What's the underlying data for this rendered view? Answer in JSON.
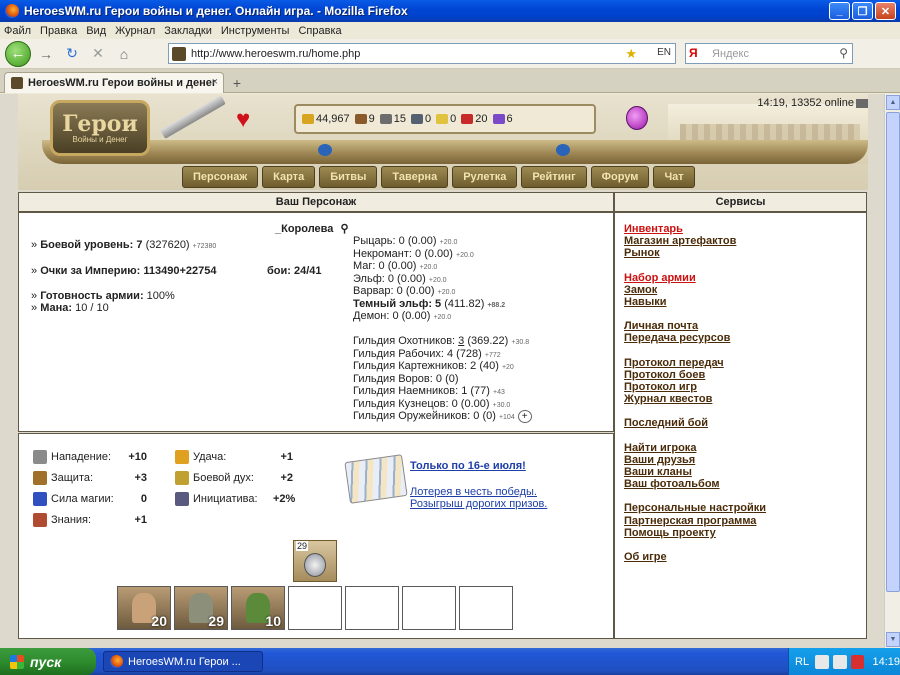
{
  "window": {
    "title": "HeroesWM.ru Герои войны и денег. Онлайн игра. - Mozilla Firefox"
  },
  "menu": [
    "Файл",
    "Правка",
    "Вид",
    "Журнал",
    "Закладки",
    "Инструменты",
    "Справка"
  ],
  "nav": {
    "url": "http://www.heroeswm.ru/home.php",
    "search_placeholder": "Яндекс",
    "lang_indicator": "EN"
  },
  "tab": {
    "title": "HeroesWM.ru Герои войны и денег"
  },
  "game": {
    "logo": {
      "title": "Герои",
      "subtitle": "Войны и Денег"
    },
    "resources": [
      {
        "icon": "gold-icon",
        "value": "44,967",
        "color": "#d8a520"
      },
      {
        "icon": "wood-icon",
        "value": "9",
        "color": "#8b5a2b"
      },
      {
        "icon": "ore-icon",
        "value": "15",
        "color": "#6d6d6d"
      },
      {
        "icon": "mercury-icon",
        "value": "0",
        "color": "#556070"
      },
      {
        "icon": "sulfur-icon",
        "value": "0",
        "color": "#e0c23c"
      },
      {
        "icon": "crystal-icon",
        "value": "20",
        "color": "#c82a2a"
      },
      {
        "icon": "gems-icon",
        "value": "6",
        "color": "#7a4ac8"
      }
    ],
    "online": "14:19, 13352 online",
    "main_menu": [
      "Персонаж",
      "Карта",
      "Битвы",
      "Таверна",
      "Рулетка",
      "Рейтинг",
      "Форум",
      "Чат"
    ]
  },
  "character_panel": {
    "header": "Ваш Персонаж",
    "name": "_Королева",
    "left": {
      "level_label": "Боевой уровень:",
      "level": "7",
      "level_exp": "(327620)",
      "level_exp_bonus": "+72380",
      "empire_label": "Очки за Империю:",
      "empire": "113490+22754",
      "fights": "бои: 24/41",
      "army_ready_label": "Готовность армии:",
      "army_ready": "100%",
      "mana_label": "Мана:",
      "mana": "10 / 10"
    },
    "factions": [
      {
        "name": "Рыцарь:",
        "level": "0",
        "skill": "(0.00)",
        "bonus": "+20.0",
        "bold": false
      },
      {
        "name": "Некромант:",
        "level": "0",
        "skill": "(0.00)",
        "bonus": "+20.0",
        "bold": false
      },
      {
        "name": "Маг:",
        "level": "0",
        "skill": "(0.00)",
        "bonus": "+20.0",
        "bold": false
      },
      {
        "name": "Эльф:",
        "level": "0",
        "skill": "(0.00)",
        "bonus": "+20.0",
        "bold": false
      },
      {
        "name": "Варвар:",
        "level": "0",
        "skill": "(0.00)",
        "bonus": "+20.0",
        "bold": false
      },
      {
        "name": "Темный эльф:",
        "level": "5",
        "skill": "(411.82)",
        "bonus": "+88.2",
        "bold": true
      },
      {
        "name": "Демон:",
        "level": "0",
        "skill": "(0.00)",
        "bonus": "+20.0",
        "bold": false
      }
    ],
    "guilds": [
      {
        "name": "Гильдия Охотников:",
        "level": "3",
        "skill": "(369.22)",
        "bonus": "+30.8"
      },
      {
        "name": "Гильдия Рабочих:",
        "level": "4",
        "skill": "(728)",
        "bonus": "+772"
      },
      {
        "name": "Гильдия Картежников:",
        "level": "2",
        "skill": "(40)",
        "bonus": "+20"
      },
      {
        "name": "Гильдия Воров:",
        "level": "0",
        "skill": "(0)",
        "bonus": ""
      },
      {
        "name": "Гильдия Наемников:",
        "level": "1",
        "skill": "(77)",
        "bonus": "+43"
      },
      {
        "name": "Гильдия Кузнецов:",
        "level": "0",
        "skill": "(0.00)",
        "bonus": "+30.0"
      },
      {
        "name": "Гильдия Оружейников:",
        "level": "0",
        "skill": "(0)",
        "bonus": "+104"
      }
    ],
    "plus_label": "+"
  },
  "stats": {
    "left": [
      {
        "label": "Нападение:",
        "value": "+10",
        "icon": "sword-icon",
        "color": "#8a8a8a"
      },
      {
        "label": "Защита:",
        "value": "+3",
        "icon": "shield-icon",
        "color": "#a0702a"
      },
      {
        "label": "Сила магии:",
        "value": "0",
        "icon": "wand-icon",
        "color": "#3050c0"
      },
      {
        "label": "Знания:",
        "value": "+1",
        "icon": "book-icon",
        "color": "#b04a30"
      }
    ],
    "right": [
      {
        "label": "Удача:",
        "value": "+1",
        "icon": "rainbow-icon",
        "color": "#e0a020"
      },
      {
        "label": "Боевой дух:",
        "value": "+2",
        "icon": "morale-icon",
        "color": "#c0a030"
      },
      {
        "label": "Инициатива:",
        "value": "+2%",
        "icon": "initiative-icon",
        "color": "#5a5a80"
      }
    ]
  },
  "promo": {
    "title": "Только по 16-е июля!",
    "line1": "Лотерея в честь победы.",
    "line2": "Розыгрыш дорогих призов."
  },
  "medal": {
    "count": "29"
  },
  "army_slots": [
    "20",
    "29",
    "10",
    "",
    "",
    "",
    ""
  ],
  "services": {
    "header": "Сервисы",
    "groups": [
      [
        {
          "label": "Инвентарь",
          "highlight": true
        },
        {
          "label": "Магазин артефактов"
        },
        {
          "label": "Рынок"
        }
      ],
      [
        {
          "label": "Набор армии",
          "highlight": true
        },
        {
          "label": "Замок"
        },
        {
          "label": "Навыки"
        }
      ],
      [
        {
          "label": "Личная почта"
        },
        {
          "label": "Передача ресурсов"
        }
      ],
      [
        {
          "label": "Протокол передач"
        },
        {
          "label": "Протокол боев"
        },
        {
          "label": "Протокол игр"
        },
        {
          "label": "Журнал квестов"
        }
      ],
      [
        {
          "label": "Последний бой"
        }
      ],
      [
        {
          "label": "Найти игрока"
        },
        {
          "label": "Ваши друзья"
        },
        {
          "label": "Ваши кланы"
        },
        {
          "label": "Ваш фотоальбом"
        }
      ],
      [
        {
          "label": "Персональные настройки"
        },
        {
          "label": "Партнерская программа"
        },
        {
          "label": "Помощь проекту"
        }
      ],
      [
        {
          "label": "Об игре"
        }
      ]
    ]
  },
  "taskbar": {
    "start": "пуск",
    "task": "HeroesWM.ru Герои ...",
    "lang": "RL",
    "time": "14:19"
  }
}
